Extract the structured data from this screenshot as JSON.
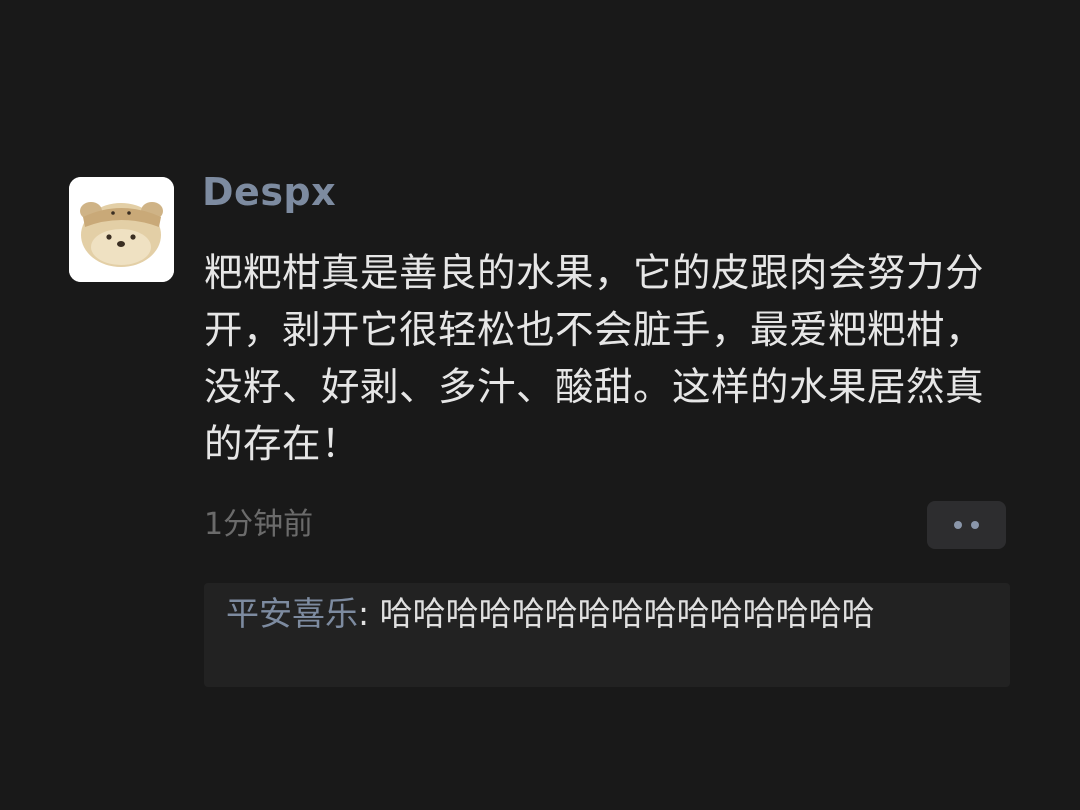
{
  "post": {
    "username": "Despx",
    "text": "粑粑柑真是善良的水果，它的皮跟肉会努力分开，剥开它很轻松也不会脏手，最爱粑粑柑，没籽、好剥、多汁、酸甜。这样的水果居然真的存在！",
    "timestamp": "1分钟前",
    "avatar_icon": "cartoon-bear-avatar"
  },
  "more_button": {
    "icon": "two-dots-icon"
  },
  "comments": [
    {
      "author": "平安喜乐",
      "separator": ": ",
      "text": "哈哈哈哈哈哈哈哈哈哈哈哈哈哈哈"
    }
  ],
  "colors": {
    "background": "#191919",
    "username": "#7d8ba0",
    "body_text": "#e6e6e6",
    "timestamp": "#6b6b6b",
    "comment_box": "#222222"
  }
}
